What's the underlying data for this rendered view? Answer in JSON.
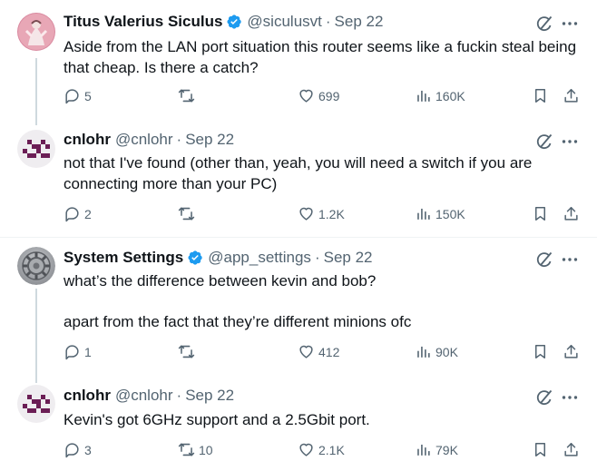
{
  "tweets": [
    {
      "name": "Titus Valerius Siculus",
      "handle": "@siculusvt",
      "date": "Sep 22",
      "lines": [
        "Aside from the LAN port situation this router seems like a fuckin steal being",
        "that cheap. Is there a catch?"
      ],
      "replies": "5",
      "retweets": "",
      "likes": "699",
      "views": "160K"
    },
    {
      "name": "cnlohr",
      "handle": "@cnlohr",
      "date": "Sep 22",
      "lines": [
        "not that I've found (other than, yeah, you will need a switch if you are",
        "connecting more than your PC)"
      ],
      "replies": "2",
      "retweets": "",
      "likes": "1.2K",
      "views": "150K"
    },
    {
      "name": "System Settings",
      "handle": "@app_settings",
      "date": "Sep 22",
      "lines": [
        "what’s the difference between kevin and bob?",
        "",
        "apart from the fact that they’re different minions ofc"
      ],
      "replies": "1",
      "retweets": "",
      "likes": "412",
      "views": "90K"
    },
    {
      "name": "cnlohr",
      "handle": "@cnlohr",
      "date": "Sep 22",
      "lines": [
        "Kevin's got 6GHz support and a 2.5Gbit port."
      ],
      "replies": "3",
      "retweets": "10",
      "likes": "2.1K",
      "views": "79K"
    }
  ],
  "separator": "·",
  "icons": {
    "verified": "verified-badge-icon",
    "grok": "grok-icon",
    "more": "more-icon",
    "reply": "reply-icon",
    "retweet": "retweet-icon",
    "like": "like-icon",
    "views": "views-icon",
    "bookmark": "bookmark-icon",
    "share": "share-icon"
  },
  "colors": {
    "verified": "#1d9bf0",
    "muted": "#536471",
    "thread": "#cfd9de",
    "avatar_pixel": "#6b1e55"
  }
}
